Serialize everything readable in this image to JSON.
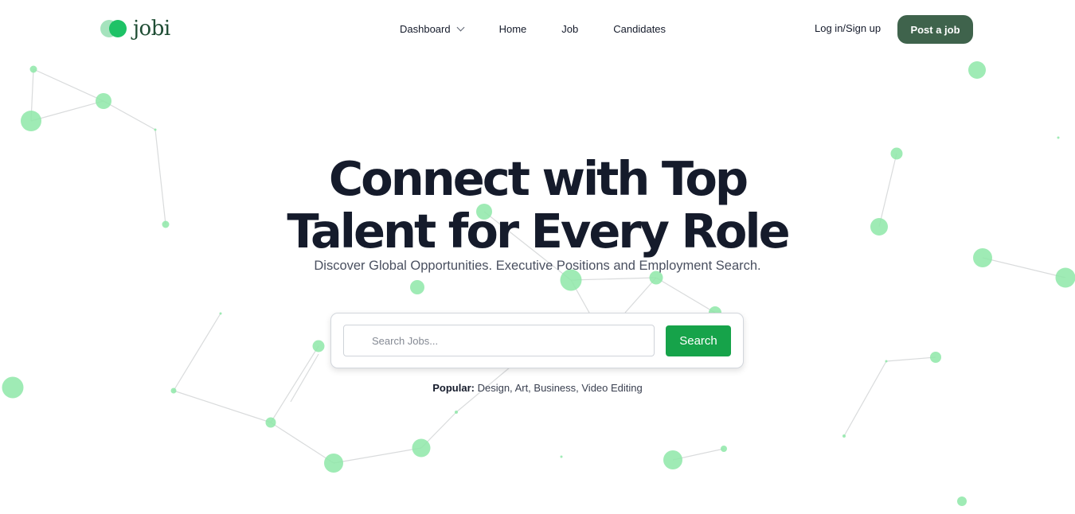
{
  "brand": {
    "name": "jobi",
    "logo_colors": [
      "#a5e3bd",
      "#1ec266"
    ],
    "text_color": "#1f4d34"
  },
  "nav": {
    "items": [
      {
        "label": "Dashboard",
        "has_dropdown": true
      },
      {
        "label": "Home"
      },
      {
        "label": "Job"
      },
      {
        "label": "Candidates"
      }
    ],
    "login_label": "Log in/Sign up",
    "post_job_label": "Post a job"
  },
  "hero": {
    "title_line1": "Connect with Top",
    "title_line2": "Talent for Every Role",
    "subtitle": "Discover Global Opportunities. Executive Positions and Employment Search."
  },
  "search": {
    "placeholder": "Search Jobs...",
    "value": "",
    "button_label": "Search"
  },
  "popular": {
    "label": "Popular:",
    "tags_text": "Design, Art, Business, Video Editing"
  },
  "colors": {
    "accent_green": "#16a34a",
    "post_job_bg": "#3f634c",
    "node_color": "#8ee8a8",
    "heading": "#151b2b"
  }
}
